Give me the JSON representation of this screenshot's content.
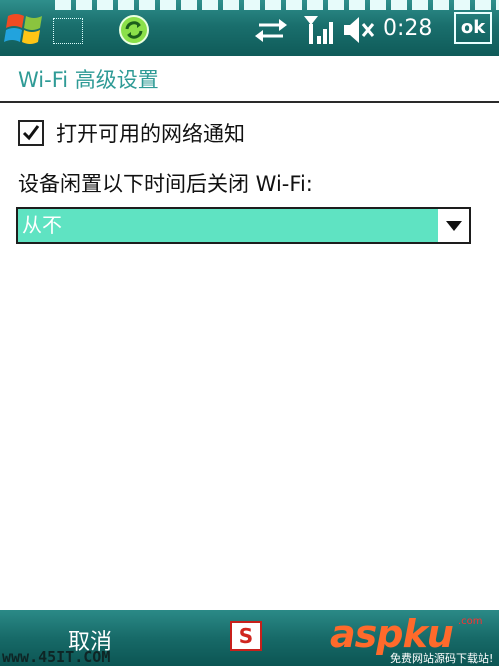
{
  "status_bar": {
    "time": "0:28",
    "ok_label": "ok",
    "icons": [
      "windows-start-icon",
      "notification-icon",
      "sync-icon",
      "connectivity-arrows-icon",
      "signal-strength-icon",
      "speaker-muted-icon"
    ]
  },
  "page": {
    "title": "Wi-Fi 高级设置"
  },
  "settings": {
    "notify_checkbox": {
      "label": "打开可用的网络通知",
      "checked": true
    },
    "idle_label": "设备闲置以下时间后关闭 Wi-Fi:",
    "idle_dropdown": {
      "selected": "从不"
    }
  },
  "softkeys": {
    "left": "取消"
  },
  "sip": {
    "label": "S"
  },
  "watermark": {
    "left": "www.45IT.COM",
    "logo": "aspku",
    "tag": ".com",
    "sub": "免费网站源码下载站!"
  },
  "colors": {
    "bar_teal": "#1a6f6d",
    "title_teal": "#2f9b96",
    "dropdown_highlight": "#5fe3c2"
  }
}
